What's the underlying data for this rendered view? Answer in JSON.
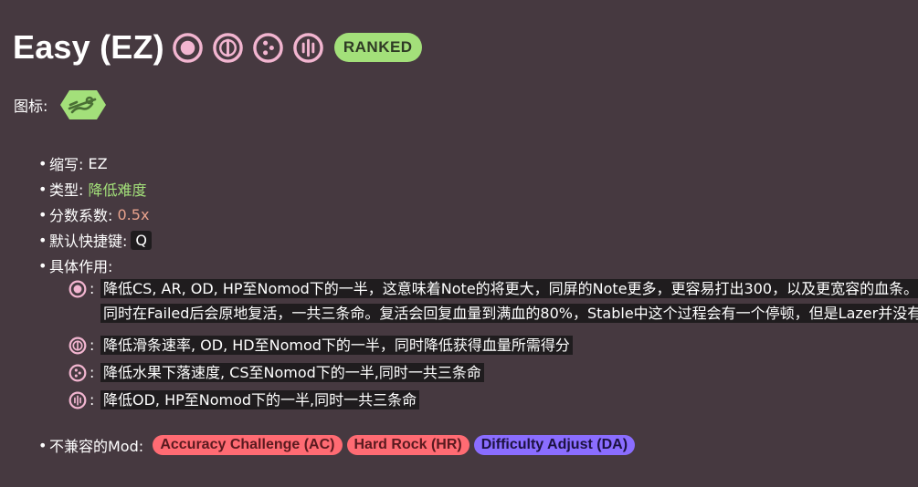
{
  "header": {
    "title": "Easy (EZ)",
    "ruleset_icons": [
      "osu-ruleset-icon",
      "taiko-ruleset-icon",
      "catch-ruleset-icon",
      "mania-ruleset-icon"
    ],
    "badge": "RANKED"
  },
  "icon_row": {
    "label": "图标:",
    "icon": "easy-mod-icon"
  },
  "info": {
    "abbr_label": "缩写:",
    "abbr_value": "EZ",
    "type_label": "类型:",
    "type_value": "降低难度",
    "multiplier_label": "分数系数:",
    "multiplier_value": "0.5x",
    "hotkey_label": "默认快捷键:",
    "hotkey_value": "Q",
    "effect_label": "具体作用:"
  },
  "effects": [
    {
      "icon": "osu-ruleset-icon",
      "text": "降低CS, AR, OD, HP至Nomod下的一半，这意味着Note的将更大，同屏的Note更多，更容易打出300，以及更宽容的血条。同时在Failed后会原地复活，一共三条命。复活会回复血量到满血的80%，Stable中这个过程会有一个停顿，但是Lazer并没有"
    },
    {
      "icon": "taiko-ruleset-icon",
      "text": "降低滑条速率, OD, HD至Nomod下的一半，同时降低获得血量所需得分"
    },
    {
      "icon": "catch-ruleset-icon",
      "text": "降低水果下落速度, CS至Nomod下的一半,同时一共三条命"
    },
    {
      "icon": "mania-ruleset-icon",
      "text": "降低OD, HP至Nomod下的一半,同时一共三条命"
    }
  ],
  "incompatible": {
    "label": "不兼容的Mod:",
    "mods": [
      {
        "name": "Accuracy Challenge (AC)",
        "color": "#ff6b73"
      },
      {
        "name": "Hard Rock (HR)",
        "color": "#ff6b73"
      },
      {
        "name": "Difficulty Adjust (DA)",
        "color": "#8a6dff"
      }
    ]
  },
  "colors": {
    "background": "#463940",
    "accent_green": "#a3e07a",
    "ruleset_pink": "#f2b5d0",
    "multiplier": "#e8a28d",
    "code_bg": "#1f1c1e"
  }
}
